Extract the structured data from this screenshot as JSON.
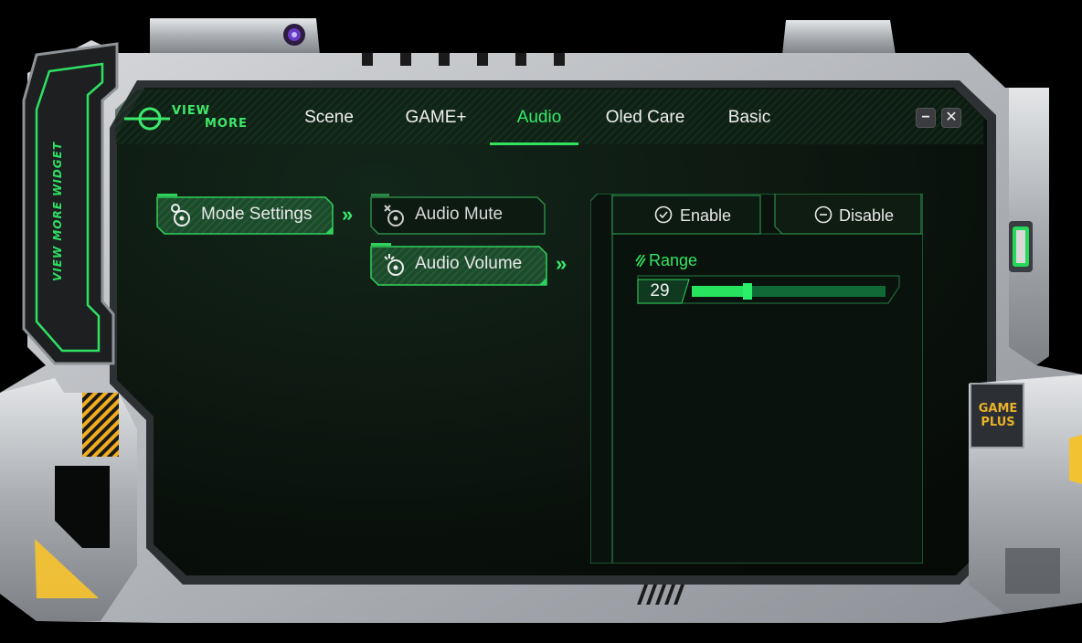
{
  "brand": {
    "logo_line1": "VIEW",
    "logo_line2": "MORE",
    "side_label": "VIEW MORE WIDGET",
    "badge_line1": "GAME",
    "badge_line2": "PLUS"
  },
  "tabs": [
    {
      "label": "Scene",
      "active": false
    },
    {
      "label": "GAME+",
      "active": false
    },
    {
      "label": "Audio",
      "active": true
    },
    {
      "label": "Oled Care",
      "active": false
    },
    {
      "label": "Basic",
      "active": false
    }
  ],
  "window_controls": {
    "minimize": "−",
    "close": "✕"
  },
  "menu": {
    "level1": {
      "label": "Mode Settings",
      "icon": "gear-disc-icon"
    },
    "level2": [
      {
        "label": "Audio Mute",
        "icon": "mute-disc-icon",
        "selected": false
      },
      {
        "label": "Audio Volume",
        "icon": "volume-disc-icon",
        "selected": true
      }
    ],
    "chevron": "»"
  },
  "panel": {
    "enable_label": "Enable",
    "disable_label": "Disable",
    "selected_option": "Enable",
    "range_label": "Range",
    "range_value": "29",
    "range_fraction": 0.29
  },
  "colors": {
    "accent": "#33e35f",
    "background": "#0b120e",
    "frame": "#b9bcc0",
    "warning": "#f3b52a"
  }
}
